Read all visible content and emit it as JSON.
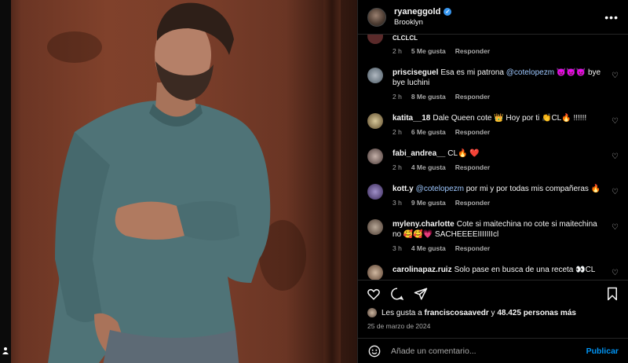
{
  "post": {
    "username": "ryaneggold",
    "location": "Brooklyn",
    "more_icon": "more-horizontal-icon"
  },
  "comments": [
    {
      "user": "",
      "text": "CLCLCL",
      "time": "2 h",
      "likes": "5 Me gusta",
      "reply": "Responder"
    },
    {
      "user": "prisciseguel",
      "text_before": "Esa es mi patrona ",
      "mention": "@cotelopezm",
      "text_after": " 😈😈😈 bye bye luchini",
      "time": "2 h",
      "likes": "8 Me gusta",
      "reply": "Responder"
    },
    {
      "user": "katita__18",
      "text": "Dale Queen cote 👑 Hoy por ti 👏CL🔥 !!!!!!",
      "time": "2 h",
      "likes": "6 Me gusta",
      "reply": "Responder"
    },
    {
      "user": "fabi_andrea__",
      "text": "CL🔥 ❤️",
      "time": "2 h",
      "likes": "4 Me gusta",
      "reply": "Responder"
    },
    {
      "user": "kott.y",
      "mention": "@cotelopezm",
      "text_after": " por mi y por todas mis compañeras 🔥",
      "time": "3 h",
      "likes": "9 Me gusta",
      "reply": "Responder"
    },
    {
      "user": "myleny.charlotte",
      "text": "Cote si maitechina no cote si maitechina no 🥰🥰💗 SACHEEEEIIIIIIIcl",
      "time": "3 h",
      "likes": "4 Me gusta",
      "reply": "Responder"
    },
    {
      "user": "carolinapaz.ruiz",
      "text": "Solo pase en busca de una receta 👀CL"
    }
  ],
  "actions": {
    "like_icon": "heart-icon",
    "comment_icon": "comment-icon",
    "share_icon": "share-icon",
    "save_icon": "bookmark-icon"
  },
  "likes": {
    "prefix": "Les gusta a ",
    "user": "franciscosaavedr",
    "middle": " y ",
    "count": "48.425 personas más"
  },
  "date": "25 de marzo de 2024",
  "add_comment": {
    "placeholder": "Añade un comentario...",
    "publish": "Publicar"
  },
  "colors": {
    "accent": "#0095f6",
    "mention": "#9ec8ff",
    "verified": "#3897f0"
  }
}
